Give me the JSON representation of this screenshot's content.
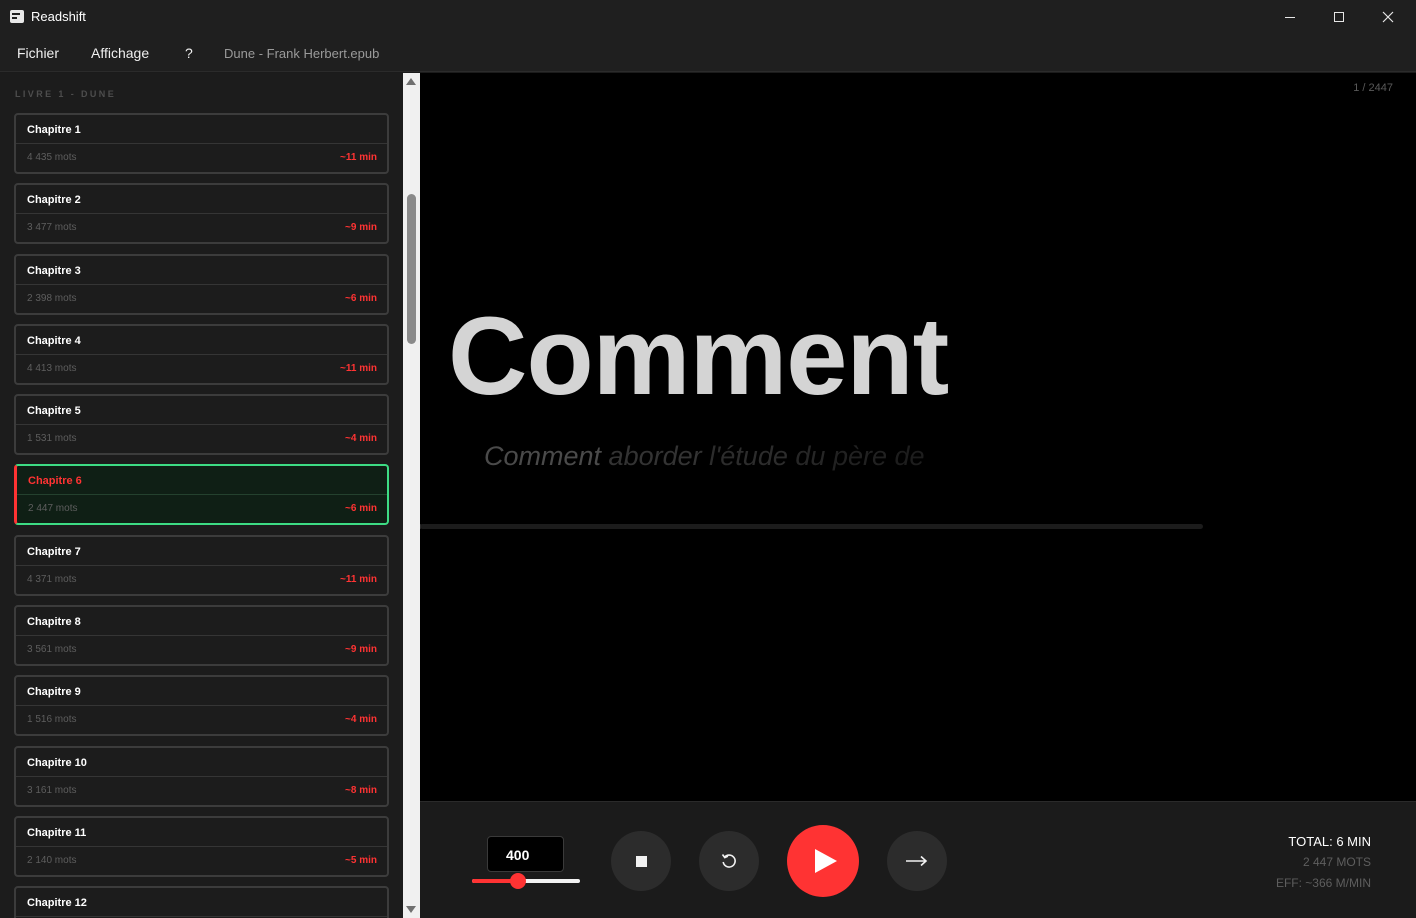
{
  "app": {
    "title": "Readshift"
  },
  "menu": {
    "file": "Fichier",
    "view": "Affichage",
    "help": "?",
    "document": "Dune - Frank Herbert.epub"
  },
  "sidebar": {
    "section_title": "LIVRE 1 - DUNE",
    "chapters": [
      {
        "label": "Chapitre 1",
        "words": "4 435 mots",
        "duration": "~11 min"
      },
      {
        "label": "Chapitre 2",
        "words": "3 477 mots",
        "duration": "~9 min"
      },
      {
        "label": "Chapitre 3",
        "words": "2 398 mots",
        "duration": "~6 min"
      },
      {
        "label": "Chapitre 4",
        "words": "4 413 mots",
        "duration": "~11 min"
      },
      {
        "label": "Chapitre 5",
        "words": "1 531 mots",
        "duration": "~4 min"
      },
      {
        "label": "Chapitre 6",
        "words": "2 447 mots",
        "duration": "~6 min",
        "active": true
      },
      {
        "label": "Chapitre 7",
        "words": "4 371 mots",
        "duration": "~11 min"
      },
      {
        "label": "Chapitre 8",
        "words": "3 561 mots",
        "duration": "~9 min"
      },
      {
        "label": "Chapitre 9",
        "words": "1 516 mots",
        "duration": "~4 min"
      },
      {
        "label": "Chapitre 10",
        "words": "3 161 mots",
        "duration": "~8 min"
      },
      {
        "label": "Chapitre 11",
        "words": "2 140 mots",
        "duration": "~5 min"
      },
      {
        "label": "Chapitre 12",
        "words": "",
        "duration": ""
      }
    ]
  },
  "reader": {
    "page_counter": "1 / 2447",
    "current_word": "Comment",
    "context": [
      "Comment",
      "aborder",
      "l'étude",
      "du",
      "père",
      "de"
    ],
    "progress_fraction": 0.0004
  },
  "controls": {
    "speed_value": "400",
    "speed_slider_fraction": 0.43,
    "total": "TOTAL: 6 MIN",
    "word_count": "2 447 MOTS",
    "effective_rate": "EFF: ~366 M/MIN"
  },
  "icons": {
    "stop": "stop-icon",
    "restart": "restart-icon",
    "play": "play-icon",
    "next": "arrow-right-icon"
  },
  "colors": {
    "accent": "#ff3333",
    "active_border": "#3ddc84",
    "background": "#000000"
  }
}
